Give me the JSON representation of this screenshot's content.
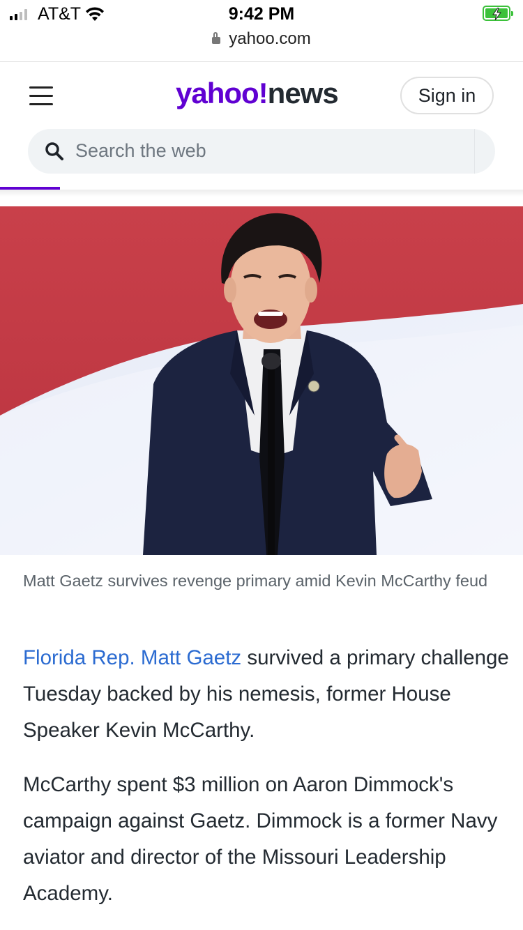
{
  "status_bar": {
    "carrier": "AT&T",
    "time": "9:42 PM",
    "url": "yahoo.com",
    "battery_color": "#3cc13b"
  },
  "header": {
    "logo_part1": "yahoo!",
    "logo_part2": "news",
    "sign_in": "Sign in",
    "search_placeholder": "Search the web",
    "brand_color": "#6001d2"
  },
  "article": {
    "image_alt": "Matt Gaetz speaking at podium",
    "caption": "Matt Gaetz survives revenge primary amid Kevin McCarthy feud",
    "paragraph1_link": "Florida Rep. Matt Gaetz",
    "paragraph1_rest": " survived a primary challenge Tuesday backed by his nemesis, former House Speaker Kevin McCarthy.",
    "paragraph2": "McCarthy spent $3 million on Aaron Dimmock's campaign against Gaetz. Dimmock is a former Navy aviator and director of the Missouri Leadership Academy.",
    "link_color": "#2b6bd1"
  }
}
